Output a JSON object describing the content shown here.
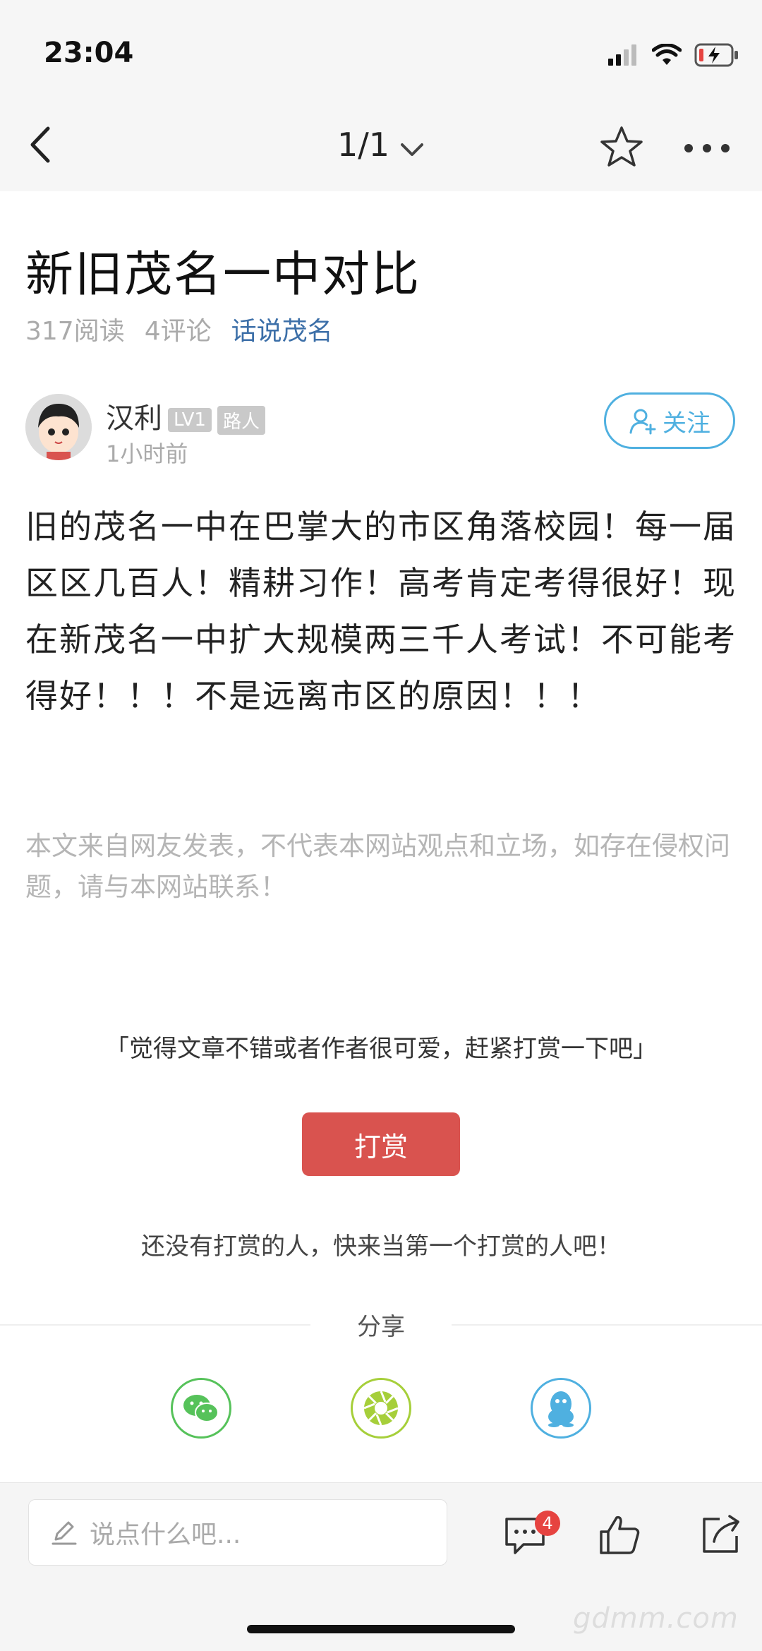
{
  "status_bar": {
    "time": "23:04"
  },
  "nav": {
    "page_indicator": "1/1"
  },
  "post": {
    "title": "新旧茂名一中对比",
    "reads": "317阅读",
    "comments": "4评论",
    "board": "话说茂名",
    "author": {
      "name": "汉利",
      "level": "LV1",
      "rank": "路人",
      "time": "1小时前"
    },
    "follow_label": "关注",
    "content": "旧的茂名一中在巴掌大的市区角落校园！每一届区区几百人！精耕习作！高考肯定考得很好！现在新茂名一中扩大规模两三千人考试！不可能考得好！！！不是远离市区的原因！！！",
    "disclaimer": "本文来自网友发表，不代表本网站观点和立场，如存在侵权问题，请与本网站联系！"
  },
  "reward": {
    "prompt": "「觉得文章不错或者作者很可爱，赶紧打赏一下吧」",
    "button_label": "打赏",
    "empty_text": "还没有打赏的人，快来当第一个打赏的人吧！"
  },
  "share": {
    "label": "分享",
    "targets": [
      {
        "icon": "wechat-icon",
        "color": "#56c25a"
      },
      {
        "icon": "moments-icon",
        "color": "#a6cf3a"
      },
      {
        "icon": "qq-icon",
        "color": "#4fb0e0"
      }
    ]
  },
  "bottom_bar": {
    "input_placeholder": "说点什么吧...",
    "comment_count": "4"
  },
  "watermark": "gdmm.com",
  "colors": {
    "accent_blue": "#4fb0e0",
    "reward_red": "#d9534f",
    "board_link": "#3c6fa8"
  }
}
